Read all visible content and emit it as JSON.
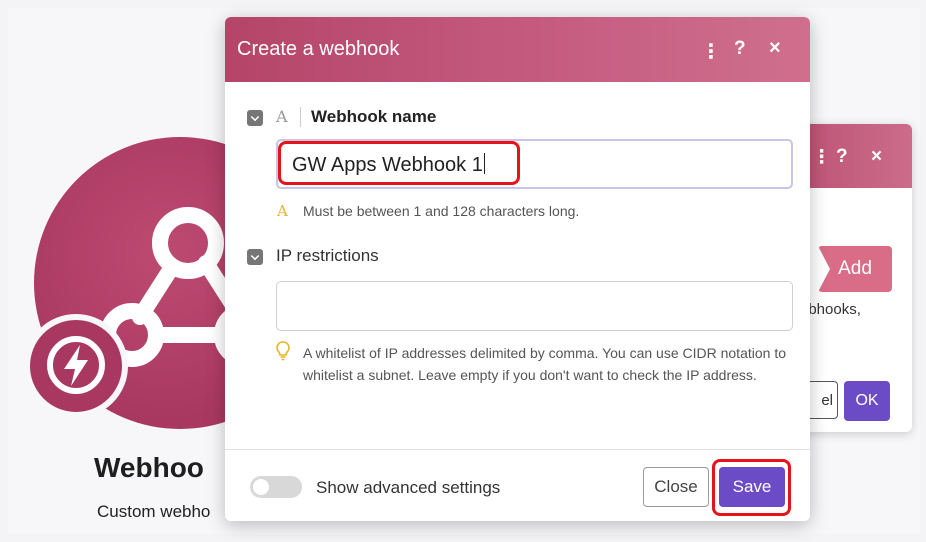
{
  "module": {
    "title": "Webhoo",
    "subtitle": "Custom webho",
    "icon": "webhook-icon",
    "badge_icon": "lightning-icon",
    "color": "#b23a62"
  },
  "back_panel": {
    "help_symbol": "?",
    "close_symbol": "×",
    "kebab_symbol": "⋮",
    "add_label": "Add",
    "text_fragment": "ebhooks,",
    "cancel_fragment": "el",
    "ok_label": "OK"
  },
  "modal": {
    "title": "Create a webhook",
    "header_actions": {
      "kebab": "⋮",
      "help": "?",
      "close": "×"
    },
    "fields": {
      "webhook_name": {
        "type_glyph": "A",
        "label": "Webhook name",
        "value": "GW Apps Webhook 1",
        "hint_glyph": "A",
        "hint": "Must be between 1 and 128 characters long."
      },
      "ip_restrictions": {
        "label": "IP restrictions",
        "value": "",
        "help": "A whitelist of IP addresses delimited by comma. You can use CIDR notation to whitelist a subnet. Leave empty if you don't want to check the IP address."
      }
    },
    "footer": {
      "toggle_label": "Show advanced settings",
      "advanced_enabled": false,
      "close_label": "Close",
      "save_label": "Save"
    }
  },
  "colors": {
    "brand": "#b23a62",
    "primary_button": "#6c4bc6",
    "annotation_highlight": "#e4141a"
  }
}
